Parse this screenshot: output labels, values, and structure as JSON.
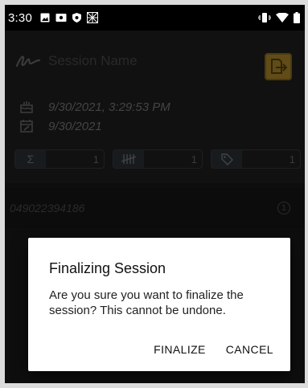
{
  "status_bar": {
    "time": "3:30"
  },
  "session": {
    "name_placeholder": "Session Name",
    "created": "9/30/2021, 3:29:53 PM",
    "due_date": "9/30/2021"
  },
  "counters": [
    {
      "icon": "sigma-icon",
      "value": "1"
    },
    {
      "icon": "tally-icon",
      "value": "1"
    },
    {
      "icon": "tag-icon",
      "value": "1"
    }
  ],
  "items": [
    {
      "barcode": "049022394186",
      "qty": "1"
    }
  ],
  "dialog": {
    "title": "Finalizing Session",
    "message": "Are you sure you want to finalize the session? This cannot be undone.",
    "finalize_label": "FINALIZE",
    "cancel_label": "CANCEL"
  },
  "colors": {
    "accent": "#b18a2b",
    "dialog_bg": "#ffffff",
    "app_bg": "#1a1a1a"
  }
}
